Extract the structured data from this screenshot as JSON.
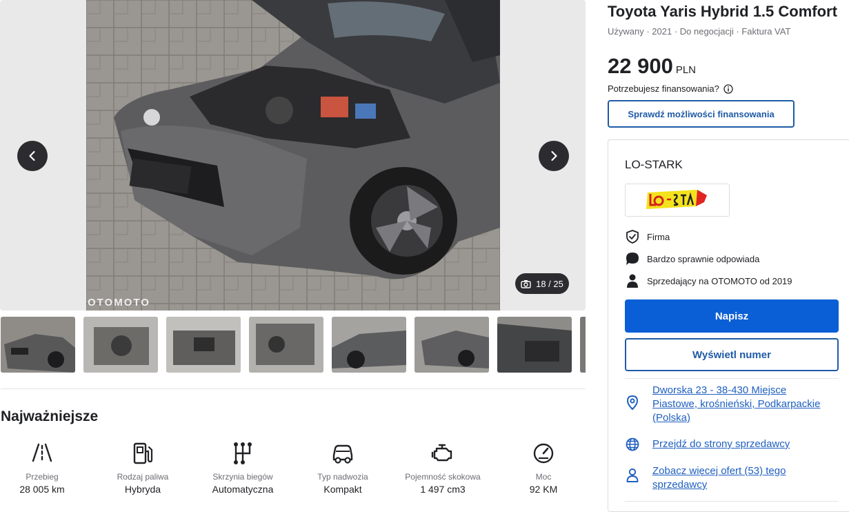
{
  "listing": {
    "title": "Toyota Yaris Hybrid 1.5 Comfort",
    "subtitle": "Używany · 2021 · Do negocjacji · Faktura VAT",
    "price": "22 900",
    "currency": "PLN",
    "finance_question": "Potrzebujesz finansowania?",
    "finance_button": "Sprawdź możliwości finansowania"
  },
  "gallery": {
    "counter": "18 / 25",
    "watermark": "OTOMOTO",
    "current_index": 18,
    "total": 25
  },
  "highlights": {
    "title": "Najważniejsze",
    "items": [
      {
        "label": "Przebieg",
        "value": "28 005 km",
        "icon": "road-icon"
      },
      {
        "label": "Rodzaj paliwa",
        "value": "Hybryda",
        "icon": "fuel-pump-icon"
      },
      {
        "label": "Skrzynia biegów",
        "value": "Automatyczna",
        "icon": "gearbox-icon"
      },
      {
        "label": "Typ nadwozia",
        "value": "Kompakt",
        "icon": "car-body-icon"
      },
      {
        "label": "Pojemność skokowa",
        "value": "1 497 cm3",
        "icon": "engine-icon"
      },
      {
        "label": "Moc",
        "value": "92 KM",
        "icon": "speedometer-icon"
      }
    ]
  },
  "seller": {
    "name": "LO-STARK",
    "logo_text": "LO-STARK",
    "features": [
      {
        "text": "Firma",
        "icon": "shield-check-icon"
      },
      {
        "text": "Bardzo sprawnie odpowiada",
        "icon": "chat-bubble-icon"
      },
      {
        "text": "Sprzedający na OTOMOTO od 2019",
        "icon": "person-icon"
      }
    ],
    "write_button": "Napisz",
    "show_number_button": "Wyświetl numer",
    "address_link": "Dworska 23 - 38-430 Miejsce Piastowe, krośnieński, Podkarpackie (Polska)",
    "website_link": "Przejdź do strony sprzedawcy",
    "more_offers_link": "Zobacz więcej ofert (53) tego sprzedawcy"
  },
  "colors": {
    "primary": "#0b5fd6",
    "link": "#1f5fbf",
    "text": "#202125",
    "muted": "#6c6c74"
  }
}
